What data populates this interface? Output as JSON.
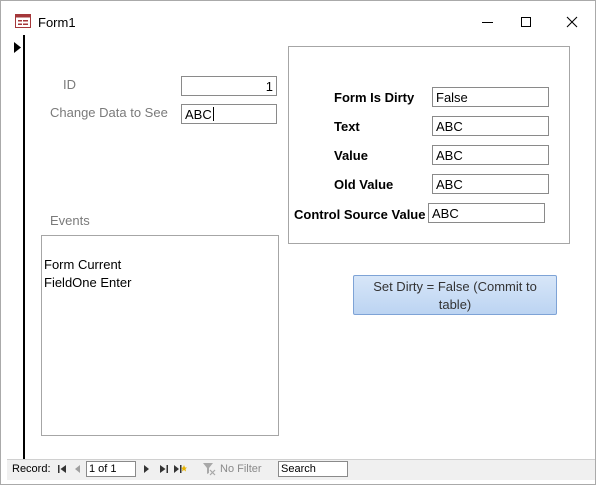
{
  "window": {
    "title": "Form1"
  },
  "form": {
    "id_label": "ID",
    "id_value": "1",
    "change_label": "Change Data to See",
    "change_value": "ABC",
    "events_label": "Events",
    "events": [
      "Form Current",
      "FieldOne Enter"
    ]
  },
  "status_panel": {
    "dirty_label": "Form Is Dirty",
    "dirty_value": "False",
    "text_label": "Text",
    "text_value": "ABC",
    "value_label": "Value",
    "value_value": "ABC",
    "old_label": "Old Value",
    "old_value": "ABC",
    "control_label": "Control Source Value",
    "control_value": "ABC"
  },
  "buttons": {
    "set_dirty_line1": "Set Dirty = False (Commit to",
    "set_dirty_line2": "table)"
  },
  "navigation": {
    "record_label": "Record:",
    "position": "1 of 1",
    "filter_label": "No Filter",
    "search_placeholder": "Search"
  }
}
